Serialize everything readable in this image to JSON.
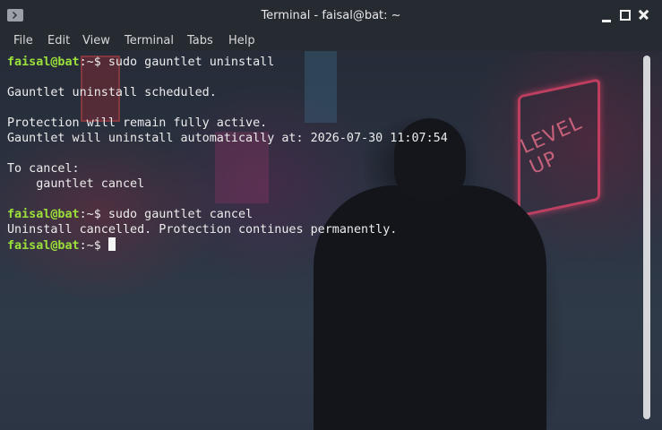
{
  "window": {
    "title": "Terminal - faisal@bat: ~"
  },
  "menu": [
    "File",
    "Edit",
    "View",
    "Terminal",
    "Tabs",
    "Help"
  ],
  "terminal": {
    "lines": [
      {
        "prompt_user": "faisal@bat",
        "prompt_path": ":~$ ",
        "command": "sudo gauntlet uninstall"
      },
      {
        "text": ""
      },
      {
        "text": "Gauntlet uninstall scheduled."
      },
      {
        "text": ""
      },
      {
        "text": "Protection will remain fully active."
      },
      {
        "text": "Gauntlet will uninstall automatically at: 2026-07-30 11:07:54"
      },
      {
        "text": ""
      },
      {
        "text": "To cancel:"
      },
      {
        "text": "    gauntlet cancel"
      },
      {
        "text": ""
      },
      {
        "prompt_user": "faisal@bat",
        "prompt_path": ":~$ ",
        "command": "sudo gauntlet cancel"
      },
      {
        "text": "Uninstall cancelled. Protection continues permanently."
      },
      {
        "prompt_user": "faisal@bat",
        "prompt_path": ":~$ ",
        "command": "",
        "cursor": true
      }
    ]
  },
  "background": {
    "sign_text": "LEVEL UP"
  },
  "colors": {
    "prompt": "#9be03a",
    "text": "#ececec",
    "titlebar": "#262a31"
  }
}
